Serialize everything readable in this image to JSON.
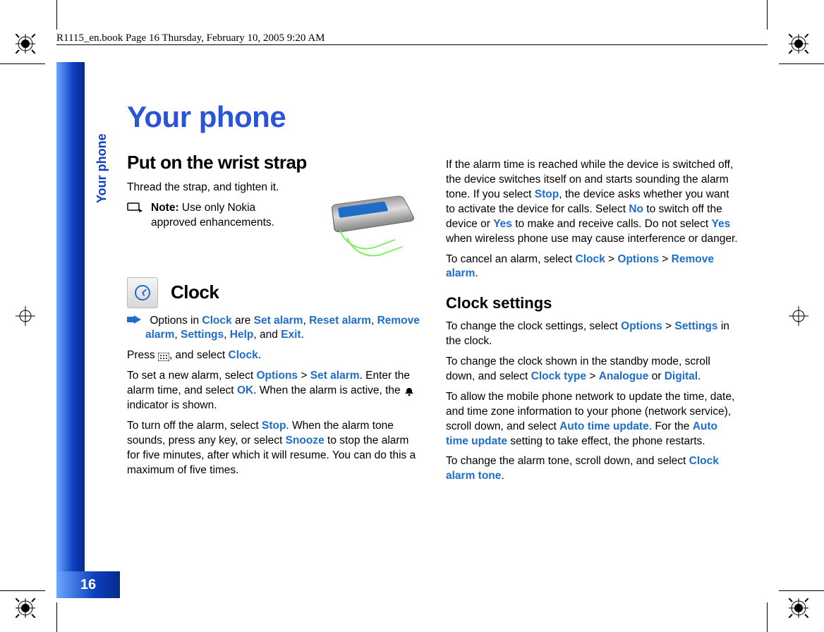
{
  "meta": {
    "header_line": "R1115_en.book  Page 16  Thursday, February 10, 2005  9:20 AM"
  },
  "side_label": "Your phone",
  "page_number": "16",
  "chapter_title": "Your phone",
  "section_wrist": {
    "heading": "Put on the wrist strap",
    "p1": "Thread the strap, and tighten it.",
    "note_label": "Note:",
    "note_body": " Use only Nokia approved enhancements."
  },
  "section_clock": {
    "heading": "Clock",
    "options_p_pre": "Options in ",
    "options_kw_clock": "Clock",
    "options_mid1": " are ",
    "options_kw_set": "Set alarm",
    "options_sep1": ", ",
    "options_kw_reset": "Reset alarm",
    "options_sep2": ", ",
    "options_kw_remove": "Remove alarm",
    "options_sep3": ", ",
    "options_kw_settings": "Settings",
    "options_sep4": ", ",
    "options_kw_help": "Help",
    "options_sep5": ", and ",
    "options_kw_exit": "Exit",
    "options_end": ".",
    "press_pre": "Press ",
    "press_mid": ", and select ",
    "press_kw": "Clock",
    "press_end": ".",
    "set_p_a": "To set a new alarm, select ",
    "set_kw_opt": "Options",
    "set_gt1": " > ",
    "set_kw_set": "Set alarm",
    "set_mid": ". Enter the alarm time, and select ",
    "set_kw_ok": "OK",
    "set_tail": ". When the alarm is active, the ",
    "set_tail2": " indicator is shown.",
    "turnoff_a": "To turn off the alarm, select ",
    "turnoff_kw_stop": "Stop",
    "turnoff_mid": ". When the alarm tone sounds, press any key, or select ",
    "turnoff_kw_snooze": "Snooze",
    "turnoff_tail": " to stop the alarm for five minutes, after which it will resume. You can do this a maximum of five times."
  },
  "col2": {
    "p1_a": "If the alarm time is reached while the device is switched off, the device switches itself on and starts sounding the alarm tone. If you select ",
    "p1_kw_stop": "Stop",
    "p1_b": ", the device asks whether you want to activate the device for calls. Select ",
    "p1_kw_no": "No",
    "p1_c": " to switch off the device or ",
    "p1_kw_yes1": "Yes",
    "p1_d": " to make and receive calls. Do not select ",
    "p1_kw_yes2": "Yes",
    "p1_e": " when wireless phone use may cause interference or danger.",
    "p2_a": "To cancel an alarm, select ",
    "p2_kw_clock": "Clock",
    "p2_gt1": " > ",
    "p2_kw_opt": "Options",
    "p2_gt2": " > ",
    "p2_kw_remove": "Remove alarm",
    "p2_end": ".",
    "h3": "Clock settings",
    "p3_a": "To change the clock settings, select ",
    "p3_kw_opt": "Options",
    "p3_gt": " > ",
    "p3_kw_set": "Settings",
    "p3_b": " in the clock.",
    "p4_a": "To change the clock shown in the standby mode, scroll down, and select ",
    "p4_kw_type": "Clock type",
    "p4_gt": " > ",
    "p4_kw_ana": "Analogue",
    "p4_or": " or ",
    "p4_kw_dig": "Digital",
    "p4_end": ".",
    "p5_a": "To allow the mobile phone network to update the time, date, and time zone information to your phone (network service), scroll down, and select ",
    "p5_kw_auto1": "Auto time update",
    "p5_b": ". For the ",
    "p5_kw_auto2": "Auto time update",
    "p5_c": " setting to take effect, the phone restarts.",
    "p6_a": "To change the alarm tone, scroll down, and select ",
    "p6_kw_tone": "Clock alarm tone",
    "p6_end": "."
  }
}
